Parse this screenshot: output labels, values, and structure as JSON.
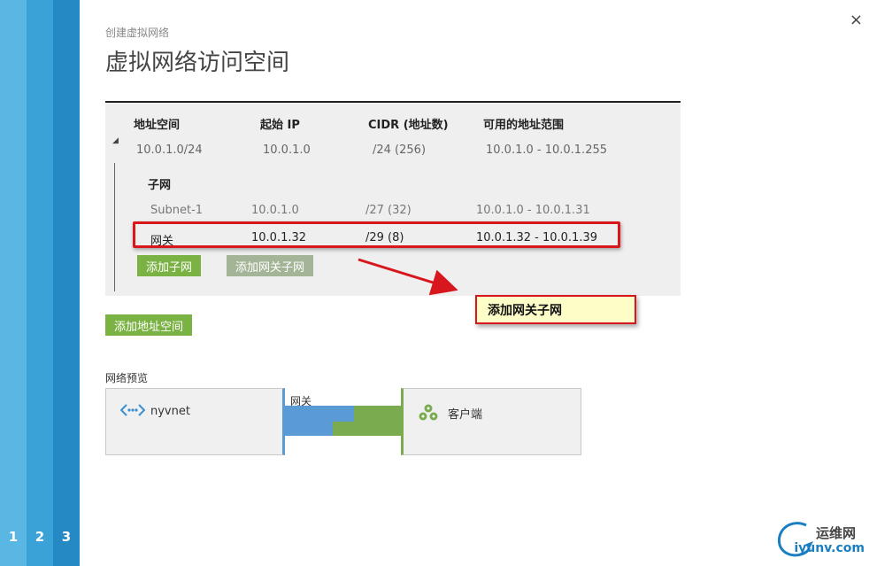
{
  "steps": [
    "1",
    "2",
    "3"
  ],
  "close_glyph": "×",
  "breadcrumb": "创建虚拟网络",
  "title": "虚拟网络访问空间",
  "address_table": {
    "headers": [
      "地址空间",
      "起始 IP",
      "CIDR (地址数)",
      "可用的地址范围"
    ],
    "row": [
      "10.0.1.0/24",
      "10.0.1.0",
      "/24 (256)",
      "10.0.1.0 - 10.0.1.255"
    ],
    "subnet_title": "子网",
    "subnets": [
      [
        "Subnet-1",
        "10.0.1.0",
        "/27 (32)",
        "10.0.1.0 - 10.0.1.31"
      ],
      [
        "网关",
        "10.0.1.32",
        "/29 (8)",
        "10.0.1.32 - 10.0.1.39"
      ]
    ],
    "add_subnet": "添加子网",
    "add_gateway_subnet": "添加网关子网"
  },
  "callout": "添加网关子网",
  "add_address_space": "添加地址空间",
  "preview": {
    "label": "网络预览",
    "left_name": "nyvnet",
    "gateway_label": "网关",
    "right_name": "客户端"
  },
  "watermark": {
    "line1": "运维网",
    "line2": "iyunv.com"
  },
  "colors": {
    "accent_green": "#7bb244",
    "callout_red": "#d8161e",
    "vnet_blue": "#5b9bd5",
    "client_green": "#7aab4f"
  }
}
